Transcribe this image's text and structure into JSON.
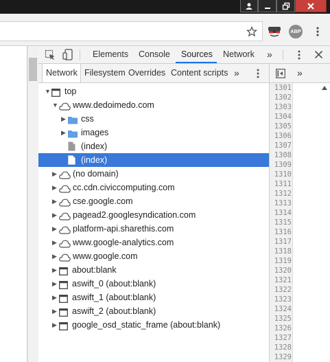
{
  "devtools": {
    "main_tabs": [
      "Elements",
      "Console",
      "Sources",
      "Network"
    ],
    "active_main_tab": "Sources",
    "overflow": "»"
  },
  "navigator": {
    "tabs": [
      "Network",
      "Filesystem",
      "Overrides",
      "Content scripts"
    ],
    "active_tab": "Network",
    "overflow": "»"
  },
  "extensions": {
    "abp_label": "ABP"
  },
  "tree": [
    {
      "label": "top",
      "level": 0,
      "icon": "frame-icon",
      "expanded": true
    },
    {
      "label": "www.dedoimedo.com",
      "level": 1,
      "icon": "cloud-icon",
      "expanded": true
    },
    {
      "label": "css",
      "level": 2,
      "icon": "folder-icon",
      "expanded": false
    },
    {
      "label": "images",
      "level": 2,
      "icon": "folder-icon",
      "expanded": false
    },
    {
      "label": "(index)",
      "level": 2,
      "icon": "file-gray-icon",
      "expanded": null
    },
    {
      "label": "(index)",
      "level": 2,
      "icon": "file-white-icon",
      "expanded": null,
      "selected": true
    },
    {
      "label": "(no domain)",
      "level": 1,
      "icon": "cloud-icon",
      "expanded": false
    },
    {
      "label": "cc.cdn.civiccomputing.com",
      "level": 1,
      "icon": "cloud-icon",
      "expanded": false
    },
    {
      "label": "cse.google.com",
      "level": 1,
      "icon": "cloud-icon",
      "expanded": false
    },
    {
      "label": "pagead2.googlesyndication.com",
      "level": 1,
      "icon": "cloud-icon",
      "expanded": false
    },
    {
      "label": "platform-api.sharethis.com",
      "level": 1,
      "icon": "cloud-icon",
      "expanded": false
    },
    {
      "label": "www.google-analytics.com",
      "level": 1,
      "icon": "cloud-icon",
      "expanded": false
    },
    {
      "label": "www.google.com",
      "level": 1,
      "icon": "cloud-icon",
      "expanded": false
    },
    {
      "label": "about:blank",
      "level": 1,
      "icon": "frame-icon",
      "expanded": false
    },
    {
      "label": "aswift_0 (about:blank)",
      "level": 1,
      "icon": "frame-icon",
      "expanded": false
    },
    {
      "label": "aswift_1 (about:blank)",
      "level": 1,
      "icon": "frame-icon",
      "expanded": false
    },
    {
      "label": "aswift_2 (about:blank)",
      "level": 1,
      "icon": "frame-icon",
      "expanded": false
    },
    {
      "label": "google_osd_static_frame (about:blank)",
      "level": 1,
      "icon": "frame-icon",
      "expanded": false
    }
  ],
  "editor": {
    "line_numbers": [
      "1301",
      "1302",
      "1303",
      "1304",
      "1305",
      "1306",
      "1307",
      "1308",
      "1309",
      "1310",
      "1311",
      "1312",
      "1313",
      "1314",
      "1315",
      "1316",
      "1317",
      "1318",
      "1319",
      "1320",
      "1321",
      "1322",
      "1323",
      "1324",
      "1325",
      "1326",
      "1327",
      "1328",
      "1329"
    ]
  },
  "colors": {
    "selection": "#3879d9",
    "active_tab_underline": "#1a73e8",
    "folder": "#5fa0e6",
    "close_button": "#c7403a"
  }
}
